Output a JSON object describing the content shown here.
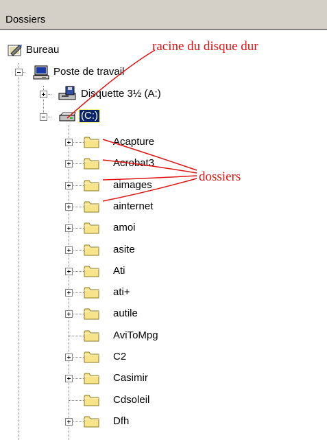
{
  "panel": {
    "title": "Dossiers"
  },
  "tree": {
    "desktop": "Bureau",
    "computer": "Poste de travail",
    "floppy": "Disquette 3½ (A:)",
    "drive_c": "(C:)",
    "folders": [
      {
        "label": "Acapture",
        "expandable": true
      },
      {
        "label": "Acrobat3",
        "expandable": true
      },
      {
        "label": "aimages",
        "expandable": true
      },
      {
        "label": "ainternet",
        "expandable": true
      },
      {
        "label": "amoi",
        "expandable": true
      },
      {
        "label": "asite",
        "expandable": true
      },
      {
        "label": "Ati",
        "expandable": true
      },
      {
        "label": "ati+",
        "expandable": true
      },
      {
        "label": "autile",
        "expandable": true
      },
      {
        "label": "AviToMpg",
        "expandable": false
      },
      {
        "label": "C2",
        "expandable": true
      },
      {
        "label": "Casimir",
        "expandable": true
      },
      {
        "label": "Cdsoleil",
        "expandable": false
      },
      {
        "label": "Dfh",
        "expandable": true
      }
    ]
  },
  "annotations": {
    "root": "racine du disque dur",
    "folders": "dossiers"
  },
  "colors": {
    "annotation": "#e01010",
    "selection": "#0a246a",
    "folder": "#f7e48a",
    "header": "#d4d0c8"
  }
}
